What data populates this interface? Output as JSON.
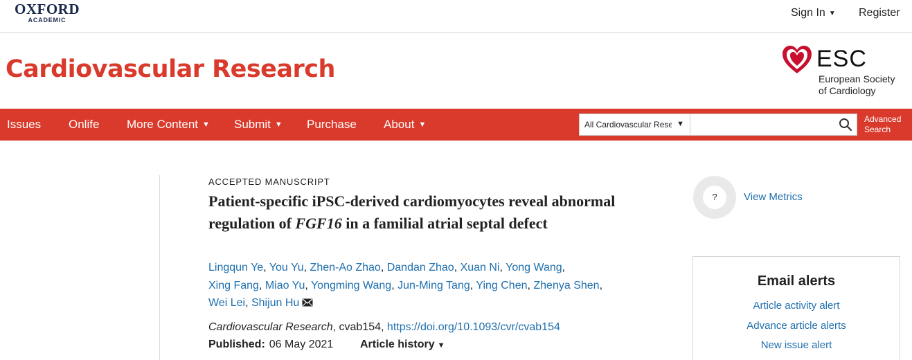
{
  "header": {
    "logo_word": "OXFORD",
    "logo_sub": "ACADEMIC",
    "sign_in": "Sign In",
    "register": "Register"
  },
  "journal": {
    "title": "Cardiovascular Research",
    "society_abbr": "ESC",
    "society_name_line1": "European Society",
    "society_name_line2": "of Cardiology"
  },
  "nav": {
    "items": [
      {
        "label": "Issues",
        "has_dropdown": false
      },
      {
        "label": "Onlife",
        "has_dropdown": false
      },
      {
        "label": "More Content",
        "has_dropdown": true
      },
      {
        "label": "Submit",
        "has_dropdown": true
      },
      {
        "label": "Purchase",
        "has_dropdown": false
      },
      {
        "label": "About",
        "has_dropdown": true
      }
    ],
    "search_scope": "All Cardiovascular Rese",
    "search_value": "",
    "advanced_line1": "Advanced",
    "advanced_line2": "Search"
  },
  "article": {
    "type": "ACCEPTED MANUSCRIPT",
    "title_part1": "Patient-specific iPSC-derived cardiomyocytes reveal abnormal regulation of ",
    "title_gene": "FGF16",
    "title_part2": " in a familial atrial septal defect",
    "authors": [
      "Lingqun Ye",
      "You Yu",
      "Zhen-Ao Zhao",
      "Dandan Zhao",
      "Xuan Ni",
      "Yong Wang",
      "Xing Fang",
      "Miao Yu",
      "Yongming Wang",
      "Jun-Ming Tang",
      "Ying Chen",
      "Zhenya Shen",
      "Wei Lei",
      "Shijun Hu"
    ],
    "journal_name": "Cardiovascular Research",
    "article_id": ", cvab154, ",
    "doi": "https://doi.org/10.1093/cvr/cvab154",
    "published_label": "Published:",
    "published_date": "06 May 2021",
    "history_label": "Article history"
  },
  "sidebar": {
    "metrics_icon_text": "?",
    "view_metrics": "View Metrics",
    "alerts_title": "Email alerts",
    "alert_links": [
      "Article activity alert",
      "Advance article alerts",
      "New issue alert"
    ]
  },
  "colors": {
    "brand_red": "#d93a2b",
    "link_blue": "#1f6fae",
    "oxford_navy": "#1a2a4f"
  }
}
